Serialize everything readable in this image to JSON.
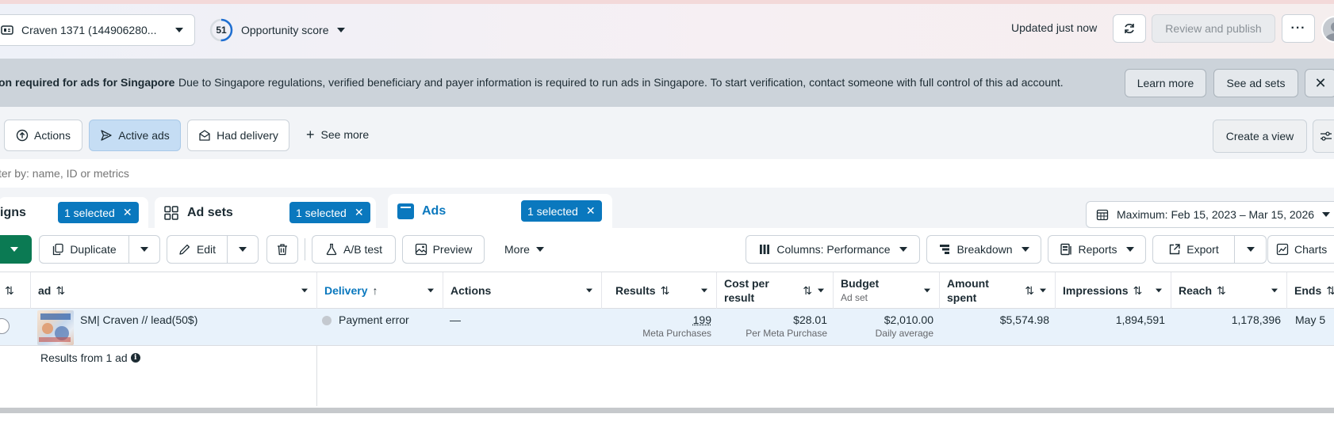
{
  "topbar": {
    "account_name": "Craven 1371 (144906280...",
    "score_value": "51",
    "score_label": "Opportunity score",
    "updated_text": "Updated just now",
    "review_publish_label": "Review and publish"
  },
  "banner": {
    "title": "on required for ads for Singapore",
    "message": "Due to Singapore regulations, verified beneficiary and payer information is required to run ads in Singapore. To start verification, contact someone with full control of this ad account.",
    "learn_more_label": "Learn more",
    "see_ad_sets_label": "See ad sets"
  },
  "filters": {
    "actions_label": "Actions",
    "active_ads_label": "Active ads",
    "had_delivery_label": "Had delivery",
    "see_more_label": "See more",
    "create_view_label": "Create a view"
  },
  "search": {
    "placeholder": "ter by: name, ID or metrics"
  },
  "level_tabs": {
    "campaigns_label": "igns",
    "campaigns_selected": "1 selected",
    "adsets_label": "Ad sets",
    "adsets_selected": "1 selected",
    "ads_label": "Ads",
    "ads_selected": "1 selected"
  },
  "date_range": {
    "label": "Maximum: Feb 15, 2023 – Mar 15, 2026"
  },
  "toolbar": {
    "duplicate_label": "Duplicate",
    "edit_label": "Edit",
    "ab_test_label": "A/B test",
    "preview_label": "Preview",
    "more_label": "More",
    "columns_label": "Columns: Performance",
    "breakdown_label": "Breakdown",
    "reports_label": "Reports",
    "export_label": "Export",
    "charts_label": "Charts"
  },
  "table": {
    "headers": {
      "ad": "ad",
      "delivery": "Delivery",
      "actions": "Actions",
      "results": "Results",
      "cost_line1": "Cost per",
      "cost_line2": "result",
      "budget": "Budget",
      "budget_sub": "Ad set",
      "amount_line1": "Amount",
      "amount_line2": "spent",
      "impressions": "Impressions",
      "reach": "Reach",
      "ends": "Ends"
    },
    "row": {
      "ad_name": "SM| Craven // lead(50$)",
      "delivery": "Payment error",
      "actions": "—",
      "results": "199",
      "results_sub": "Meta Purchases",
      "cost": "$28.01",
      "cost_sub": "Per Meta Purchase",
      "budget": "$2,010.00",
      "budget_sub": "Daily average",
      "amount_spent": "$5,574.98",
      "impressions": "1,894,591",
      "reach": "1,178,396",
      "ends": "May 5"
    },
    "summary": "Results from 1 ad"
  },
  "colors": {
    "accent": "#0a78be",
    "active_filter_bg": "#c5ddf4",
    "banner_bg": "#ccd3da",
    "publish_green": "#0b7a53"
  }
}
